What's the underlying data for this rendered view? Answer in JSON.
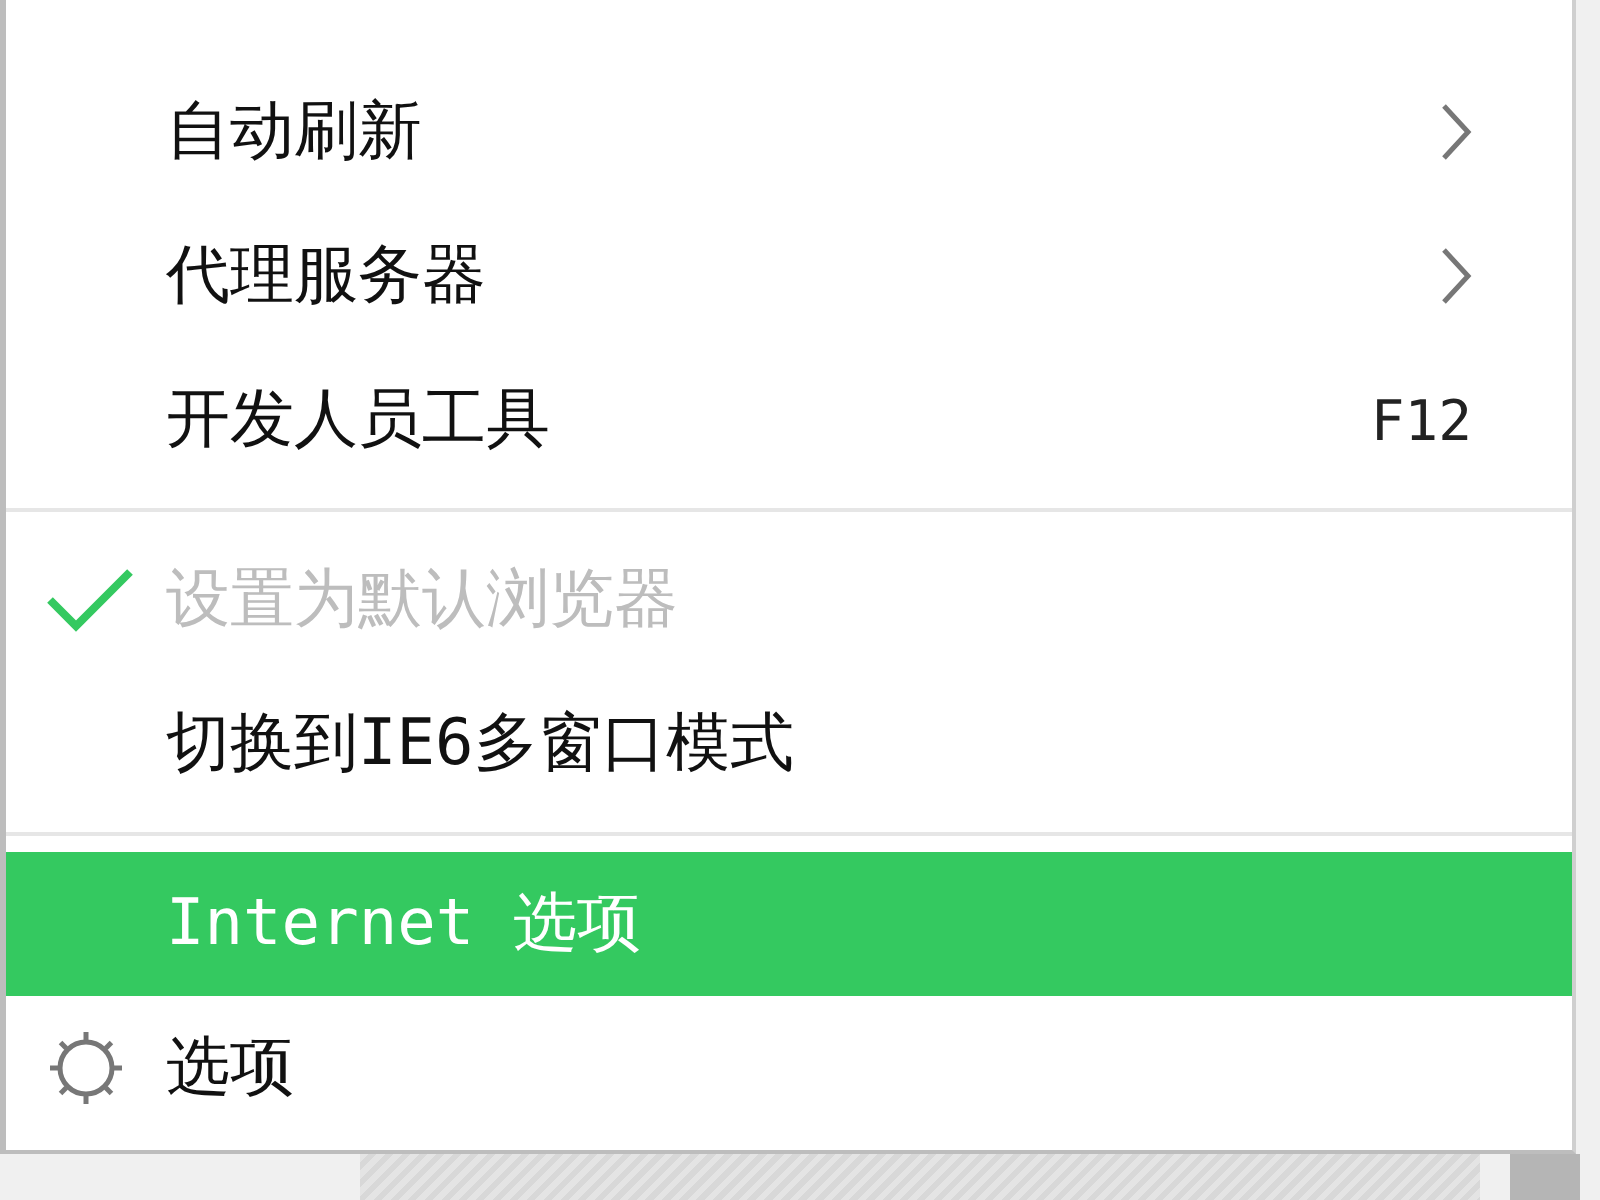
{
  "menu": {
    "items": [
      {
        "kind": "submenu",
        "label": "自动刷新",
        "checked": false,
        "disabled": false,
        "selected": false
      },
      {
        "kind": "submenu",
        "label": "代理服务器",
        "checked": false,
        "disabled": false,
        "selected": false
      },
      {
        "kind": "shortcut",
        "label": "开发人员工具",
        "shortcut": "F12",
        "checked": false,
        "disabled": false,
        "selected": false
      },
      {
        "kind": "separator"
      },
      {
        "kind": "plain",
        "label": "设置为默认浏览器",
        "checked": true,
        "disabled": true,
        "selected": false
      },
      {
        "kind": "plain",
        "label": "切换到IE6多窗口模式",
        "checked": false,
        "disabled": false,
        "selected": false
      },
      {
        "kind": "separator"
      },
      {
        "kind": "plain",
        "label": "Internet 选项",
        "checked": false,
        "disabled": false,
        "selected": true
      },
      {
        "kind": "gear",
        "label": "选项",
        "checked": false,
        "disabled": false,
        "selected": false
      }
    ]
  }
}
